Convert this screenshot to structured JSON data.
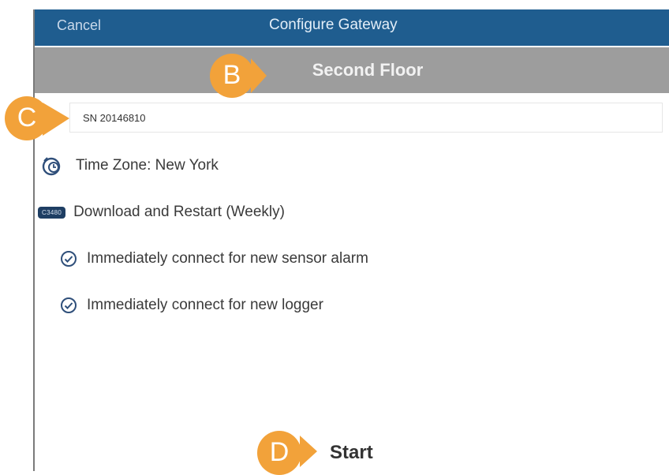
{
  "navbar": {
    "cancel_label": "Cancel",
    "title": "Configure Gateway"
  },
  "subheader": {
    "title": "Second Floor"
  },
  "serial_field": {
    "value": "SN 20146810"
  },
  "settings": {
    "time_zone": "Time Zone: New York",
    "download_badge": "C3480",
    "download": "Download and Restart (Weekly)",
    "sensor_alarm": "Immediately connect for new sensor alarm",
    "new_logger": "Immediately connect for new logger"
  },
  "start_label": "Start",
  "markers": {
    "b": "B",
    "c": "C",
    "d": "D"
  },
  "colors": {
    "navbar": "#1f5d8f",
    "subheader": "#9d9d9d",
    "marker": "#f2a23a",
    "badge": "#1e3e63"
  },
  "icons": [
    "clock-icon",
    "check-circle-icon",
    "check-circle-icon"
  ]
}
